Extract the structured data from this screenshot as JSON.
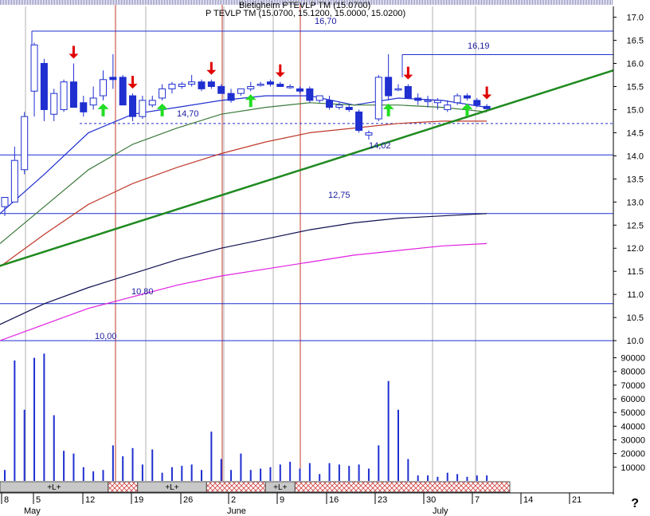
{
  "window": {
    "title_line1": "Bietigheim PTEVLP TM (15.0700)",
    "title_line2": "P TEVLP TM (15.0700, 15.1200, 15.0000, 15.0200)",
    "help_glyph": "?"
  },
  "chart_data": {
    "type": "candlestick",
    "title": "P TEVLP TM (15.0700, 15.1200, 15.0000, 15.0200)",
    "price_axis": {
      "ticks": [
        "17.0",
        "16.5",
        "16.0",
        "15.5",
        "15.0",
        "14.5",
        "14.0",
        "13.5",
        "13.0",
        "12.5",
        "12.0",
        "11.5",
        "11.0",
        "10.5",
        "10.0"
      ],
      "ylim": [
        9.95,
        17.2
      ]
    },
    "volume_axis": {
      "ticks": [
        "90000",
        "80000",
        "70000",
        "60000",
        "50000",
        "40000",
        "30000",
        "20000",
        "10000"
      ],
      "ylim": [
        0,
        95000
      ]
    },
    "x_axis": {
      "day_labels": [
        "8",
        "5",
        "12",
        "19",
        "26",
        "2",
        "9",
        "16",
        "23",
        "30",
        "7",
        "14",
        "21"
      ],
      "month_labels": [
        "May",
        "June",
        "July"
      ]
    },
    "level_labels": [
      "16,70",
      "16,19",
      "14,70",
      "14,02",
      "12,75",
      "10,80",
      "10,00"
    ],
    "horizontal_levels": [
      16.7,
      16.19,
      14.02,
      12.75,
      10.8,
      10.0
    ],
    "support_dashed": 14.7,
    "trendline": {
      "from_price": 11.62,
      "to_price": 15.85
    },
    "candles": [
      {
        "o": 12.9,
        "h": 13.05,
        "l": 12.7,
        "c": 13.1
      },
      {
        "o": 13.0,
        "h": 14.2,
        "l": 13.0,
        "c": 13.9
      },
      {
        "o": 13.7,
        "h": 14.95,
        "l": 13.6,
        "c": 14.85
      },
      {
        "o": 15.4,
        "h": 16.45,
        "l": 14.85,
        "c": 16.4
      },
      {
        "o": 16.0,
        "h": 16.1,
        "l": 14.75,
        "c": 15.0
      },
      {
        "o": 14.9,
        "h": 15.45,
        "l": 14.75,
        "c": 15.35
      },
      {
        "o": 15.0,
        "h": 15.65,
        "l": 14.95,
        "c": 15.6
      },
      {
        "o": 15.6,
        "h": 16.0,
        "l": 15.3,
        "c": 15.05
      },
      {
        "o": 15.15,
        "h": 15.3,
        "l": 14.85,
        "c": 14.95
      },
      {
        "o": 15.1,
        "h": 15.5,
        "l": 15.0,
        "c": 15.25
      },
      {
        "o": 15.3,
        "h": 15.85,
        "l": 15.2,
        "c": 15.65
      },
      {
        "o": 15.7,
        "h": 16.2,
        "l": 15.45,
        "c": 15.65
      },
      {
        "o": 15.7,
        "h": 15.75,
        "l": 15.1,
        "c": 15.1
      },
      {
        "o": 15.3,
        "h": 15.35,
        "l": 14.75,
        "c": 14.85
      },
      {
        "o": 14.85,
        "h": 15.3,
        "l": 14.8,
        "c": 15.2
      },
      {
        "o": 15.1,
        "h": 15.3,
        "l": 15.05,
        "c": 15.2
      },
      {
        "o": 15.25,
        "h": 15.55,
        "l": 15.2,
        "c": 15.45
      },
      {
        "o": 15.45,
        "h": 15.6,
        "l": 15.35,
        "c": 15.55
      },
      {
        "o": 15.5,
        "h": 15.6,
        "l": 15.45,
        "c": 15.55
      },
      {
        "o": 15.55,
        "h": 15.75,
        "l": 15.5,
        "c": 15.6
      },
      {
        "o": 15.6,
        "h": 15.65,
        "l": 15.4,
        "c": 15.45
      },
      {
        "o": 15.6,
        "h": 15.65,
        "l": 15.45,
        "c": 15.5
      },
      {
        "o": 15.5,
        "h": 15.55,
        "l": 15.35,
        "c": 15.35
      },
      {
        "o": 15.35,
        "h": 15.45,
        "l": 15.15,
        "c": 15.2
      },
      {
        "o": 15.35,
        "h": 15.45,
        "l": 15.3,
        "c": 15.45
      },
      {
        "o": 15.45,
        "h": 15.6,
        "l": 15.4,
        "c": 15.5
      },
      {
        "o": 15.55,
        "h": 15.6,
        "l": 15.5,
        "c": 15.55
      },
      {
        "o": 15.6,
        "h": 15.65,
        "l": 15.5,
        "c": 15.55
      },
      {
        "o": 15.55,
        "h": 15.6,
        "l": 15.5,
        "c": 15.5
      },
      {
        "o": 15.5,
        "h": 15.55,
        "l": 15.45,
        "c": 15.5
      },
      {
        "o": 15.45,
        "h": 15.5,
        "l": 15.35,
        "c": 15.4
      },
      {
        "o": 15.45,
        "h": 15.5,
        "l": 15.15,
        "c": 15.2
      },
      {
        "o": 15.2,
        "h": 15.3,
        "l": 15.15,
        "c": 15.3
      },
      {
        "o": 15.2,
        "h": 15.3,
        "l": 15.0,
        "c": 15.05
      },
      {
        "o": 15.05,
        "h": 15.15,
        "l": 15.0,
        "c": 15.1
      },
      {
        "o": 15.05,
        "h": 15.1,
        "l": 14.95,
        "c": 15.0
      },
      {
        "o": 14.95,
        "h": 15.0,
        "l": 14.5,
        "c": 14.55
      },
      {
        "o": 14.45,
        "h": 14.55,
        "l": 14.35,
        "c": 14.5
      },
      {
        "o": 14.8,
        "h": 15.75,
        "l": 14.75,
        "c": 15.7
      },
      {
        "o": 15.7,
        "h": 16.2,
        "l": 15.2,
        "c": 15.3
      },
      {
        "o": 15.45,
        "h": 15.55,
        "l": 15.4,
        "c": 15.45
      },
      {
        "o": 15.5,
        "h": 15.55,
        "l": 15.25,
        "c": 15.25
      },
      {
        "o": 15.25,
        "h": 15.35,
        "l": 15.1,
        "c": 15.2
      },
      {
        "o": 15.2,
        "h": 15.3,
        "l": 15.05,
        "c": 15.2
      },
      {
        "o": 15.15,
        "h": 15.25,
        "l": 15.0,
        "c": 15.2
      },
      {
        "o": 15.0,
        "h": 15.2,
        "l": 14.95,
        "c": 15.1
      },
      {
        "o": 15.15,
        "h": 15.35,
        "l": 15.1,
        "c": 15.3
      },
      {
        "o": 15.3,
        "h": 15.35,
        "l": 15.2,
        "c": 15.25
      },
      {
        "o": 15.2,
        "h": 15.25,
        "l": 15.05,
        "c": 15.1
      },
      {
        "o": 15.07,
        "h": 15.12,
        "l": 15.0,
        "c": 15.02
      }
    ],
    "volumes": [
      8000,
      88000,
      52000,
      90000,
      93000,
      48000,
      22000,
      20000,
      10000,
      7000,
      8000,
      26000,
      18000,
      24000,
      12000,
      23000,
      6000,
      10000,
      11000,
      12000,
      8000,
      36000,
      16000,
      8000,
      20000,
      8000,
      9000,
      10000,
      12000,
      14000,
      9000,
      13000,
      5000,
      13000,
      12000,
      11000,
      12000,
      9000,
      26000,
      73000,
      52000,
      16000,
      4000,
      4000,
      3000,
      6000,
      5000,
      3000,
      4000,
      4000
    ],
    "signals": [
      {
        "bar": 7,
        "type": "sell"
      },
      {
        "bar": 10,
        "type": "buy"
      },
      {
        "bar": 13,
        "type": "sell"
      },
      {
        "bar": 16,
        "type": "buy"
      },
      {
        "bar": 21,
        "type": "sell"
      },
      {
        "bar": 25,
        "type": "buy"
      },
      {
        "bar": 28,
        "type": "sell"
      },
      {
        "bar": 39,
        "type": "buy"
      },
      {
        "bar": 41,
        "type": "sell"
      },
      {
        "bar": 47,
        "type": "buy"
      },
      {
        "bar": 49,
        "type": "sell"
      }
    ],
    "bottom_bands": [
      {
        "label": "+L+",
        "from": 0,
        "to": 11,
        "style": "plain"
      },
      {
        "label": "",
        "from": 11,
        "to": 14,
        "style": "hatch"
      },
      {
        "label": "+L+",
        "from": 14,
        "to": 21,
        "style": "plain"
      },
      {
        "label": "",
        "from": 21,
        "to": 27,
        "style": "hatch"
      },
      {
        "label": "+L+",
        "from": 27,
        "to": 30,
        "style": "plain"
      },
      {
        "label": "",
        "from": 30,
        "to": 50,
        "style": "hatch"
      }
    ],
    "colors": {
      "bull": "#ffffff",
      "bear": "#1f2fd0",
      "candle_edge": "#1f2fd0",
      "level": "#1f2fd0",
      "vline": "#c0392b",
      "grid_v": "#b0b0b0",
      "trend": "#1f8a1f",
      "ma_fast": "#1f2fd0",
      "ma_green": "#3c7a3c",
      "ma_red": "#c0392b",
      "ma_navy": "#101050",
      "ma_magenta": "#e020e0",
      "sell": "#e00000",
      "buy": "#22dd22",
      "hatch": "#d04040"
    }
  }
}
